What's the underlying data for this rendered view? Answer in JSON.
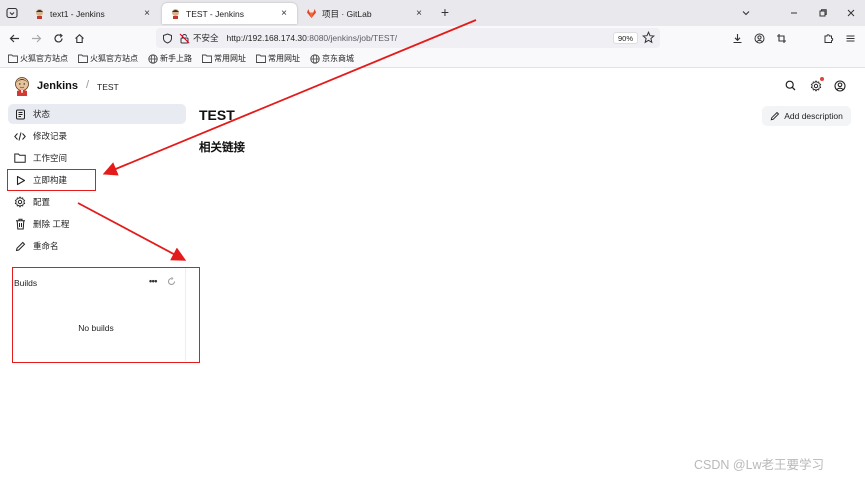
{
  "browser": {
    "tabs": [
      {
        "title": "text1 - Jenkins",
        "active": false
      },
      {
        "title": "TEST - Jenkins",
        "active": true
      },
      {
        "title": "项目 · GitLab",
        "active": false
      }
    ],
    "security_label": "不安全",
    "url_host": "http://192.168.174.30",
    "url_rest": ":8080/jenkins/job/TEST/",
    "zoom": "90%",
    "bookmarks": [
      "火狐官方站点",
      "火狐官方站点",
      "新手上路",
      "常用网址",
      "常用网址",
      "京东商城"
    ]
  },
  "jenkins": {
    "brand": "Jenkins",
    "breadcrumb_sep": "/",
    "breadcrumb": "TEST",
    "sidebar": [
      {
        "label": "状态",
        "icon": "status-icon"
      },
      {
        "label": "修改记录",
        "icon": "code-icon"
      },
      {
        "label": "工作空间",
        "icon": "folder-icon"
      },
      {
        "label": "立即构建",
        "icon": "play-icon"
      },
      {
        "label": "配置",
        "icon": "gear-icon"
      },
      {
        "label": "删除 工程",
        "icon": "trash-icon"
      },
      {
        "label": "重命名",
        "icon": "pencil-icon"
      }
    ],
    "builds": {
      "title": "Builds",
      "more": "•••",
      "empty": "No builds"
    },
    "page_title": "TEST",
    "section_title": "相关链接",
    "add_description": "Add description"
  },
  "colors": {
    "annotation": "#e31b1b",
    "sidebar_active": "#e8ebf1"
  },
  "watermark": "CSDN @Lw老王要学习"
}
